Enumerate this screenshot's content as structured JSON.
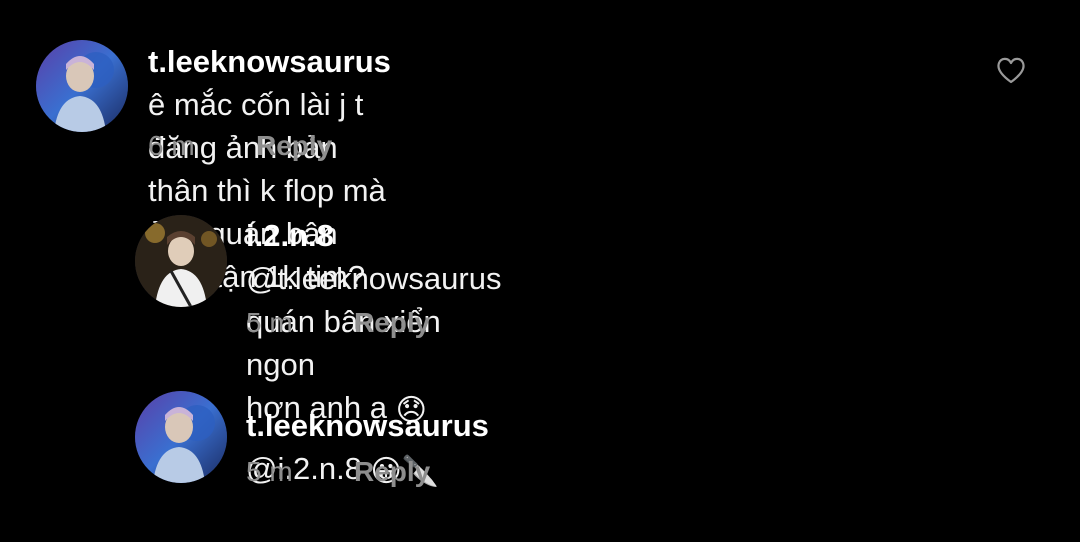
{
  "comments": [
    {
      "username": "t.leeknowsaurus",
      "text_line1": "ê mắc cốn lài j t đăng ảnh bản",
      "text_line2": "thân thì k flop mà ảnh quán bân xiển tận 1k tim?",
      "time": "6 m",
      "reply_label": "Reply",
      "icon": "heart-outline-icon"
    },
    {
      "username": "i.2.n.8",
      "text_line1": "@t.leeknowsaurus quán bân xiển ngon",
      "text_line2": "hơn anh ạ",
      "emoji": "😞",
      "time": "5 m",
      "reply_label": "Reply"
    },
    {
      "username": "t.leeknowsaurus",
      "text_line1": "@i.2.n.8",
      "emoji": "😀🔪",
      "time": "5 m",
      "reply_label": "Reply"
    }
  ],
  "colors": {
    "background": "#000000",
    "text": "#f2f2f2",
    "muted": "#8e8e8e"
  }
}
